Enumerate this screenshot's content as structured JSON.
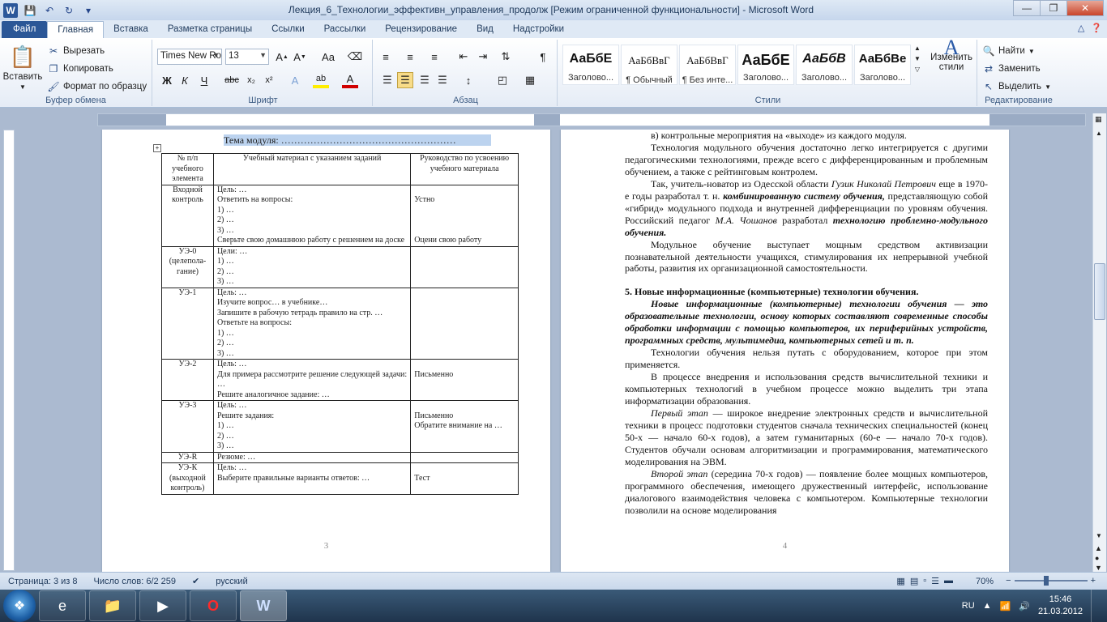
{
  "window": {
    "title": "Лекция_6_Технологии_эффективн_управления_продолж [Режим ограниченной функциональности] - Microsoft Word",
    "app_logo": "W"
  },
  "tabs": [
    "Файл",
    "Главная",
    "Вставка",
    "Разметка страницы",
    "Ссылки",
    "Рассылки",
    "Рецензирование",
    "Вид",
    "Надстройки"
  ],
  "ribbon": {
    "clipboard": {
      "label": "Буфер обмена",
      "paste": "Вставить",
      "cut": "Вырезать",
      "copy": "Копировать",
      "format_painter": "Формат по образцу"
    },
    "font": {
      "label": "Шрифт",
      "font_name": "Times New Ro",
      "font_size": "13"
    },
    "paragraph": {
      "label": "Абзац"
    },
    "styles": {
      "label": "Стили",
      "items": [
        {
          "sample": "АаБбЕ",
          "name": "Заголово..."
        },
        {
          "sample": "АаБбВвГ",
          "name": "¶ Обычный"
        },
        {
          "sample": "АаБбВвГ",
          "name": "¶ Без инте..."
        },
        {
          "sample": "АаБбЕ",
          "name": "Заголово..."
        },
        {
          "sample": "АаБбВ",
          "name": "Заголово..."
        },
        {
          "sample": "АаБбВе",
          "name": "Заголово..."
        }
      ],
      "change_styles": "Изменить стили"
    },
    "editing": {
      "label": "Редактирование",
      "find": "Найти",
      "replace": "Заменить",
      "select": "Выделить"
    }
  },
  "page3": {
    "module_title": "Тема модуля: ………………………………………………",
    "page_number": "3",
    "table": {
      "headers": [
        "№ п/п учебного элемента",
        "Учебный материал с указанием заданий",
        "Руководство по усвоению учебного материала"
      ],
      "rows": [
        {
          "c1": "Входной контроль",
          "c2": [
            "Цель: …",
            "Ответить на вопросы:",
            "1) …",
            "2) …",
            "3) …",
            "Сверьте свою домашнюю работу с решением на доске"
          ],
          "c3": [
            "",
            "Устно",
            "",
            "",
            "",
            "",
            "Оцени свою работу"
          ]
        },
        {
          "c1": "УЭ-0 (целепола-гание)",
          "c2": [
            "Цели: …",
            "1) …",
            "2) …",
            "3) …"
          ],
          "c3": []
        },
        {
          "c1": "УЭ-1",
          "c2": [
            "Цель: …",
            "Изучите вопрос… в учебнике…",
            "Запишите в рабочую тетрадь правило на стр. …",
            "Ответьте на вопросы:",
            "1) …",
            "2) …",
            "3) …"
          ],
          "c3": []
        },
        {
          "c1": "УЭ-2",
          "c2": [
            "Цель: …",
            "Для примера рассмотрите решение следующей задачи: …",
            "Решите аналогичное задание: …"
          ],
          "c3": [
            "",
            "",
            "Письменно"
          ]
        },
        {
          "c1": "УЭ-3",
          "c2": [
            "Цель: …",
            "Решите задания:",
            "1) …",
            "2) …",
            "3) …"
          ],
          "c3": [
            "",
            "Письменно",
            "Обратите внимание на …"
          ]
        },
        {
          "c1": "УЭ-R",
          "c2": [
            "Резюме: …"
          ],
          "c3": []
        },
        {
          "c1": "УЭ-К (выходной контроль)",
          "c2": [
            "Цель: …",
            "Выберите правильные варианты ответов: …"
          ],
          "c3": [
            "",
            "Тест"
          ]
        }
      ]
    }
  },
  "page4": {
    "page_number": "4",
    "p1": "в) контрольные мероприятия на «выходе» из каждого модуля.",
    "p2": "Технология модульного обучения достаточно легко интегрируется с другими педагогическими технологиями, прежде всего с дифференцированным и проблемным обучением, а также с рейтинговым контролем.",
    "p3a": "Так, учитель-новатор из Одесской области ",
    "p3b": "Гузик Николай Петрович",
    "p3c": " еще в 1970-е годы разработал т. н. ",
    "p3d": "комбинированную систему обучения,",
    "p3e": " представляющую собой «гибрид» модульного подхода и внутренней дифференциации по уровням обучения. Российский педагог ",
    "p3f": "М.А. Чошанов",
    "p3g": " разработал ",
    "p3h": "технологию проблемно-модульного обучения.",
    "p4": "Модульное обучение выступает мощным средством активизации познавательной деятельности учащихся, стимулирования их непрерывной учебной работы, развития их организационной самостоятельности.",
    "heading": "5. Новые информационные (компьютерные) технологии обучения.",
    "p5": "Новые информационные (компьютерные) технологии обучения — это образовательные технологии, основу которых составляют современные способы обработки информации с помощью компьютеров, их периферийных устройств, программных средств, мультимедиа, компьютерных сетей и т. п.",
    "p6": "Технологии обучения нельзя путать с оборудованием, которое при этом применяется.",
    "p7": "В процессе внедрения и использования средств вычислительной техники и компьютерных технологий в учебном процессе можно выделить три этапа информатизации образования.",
    "p8a": "Первый этап",
    "p8b": " — широкое внедрение электронных средств и вычислительной техники в процесс подготовки студентов сначала технических специальностей (конец 50-х — начало 60-х годов), а затем гуманитарных (60-е — начало 70-х годов). Студентов обучали основам алгоритмизации и программирования, математического моделирования на ЭВМ.",
    "p9a": "Второй этап",
    "p9b": " (середина 70-х годов) — появление более мощных компьютеров, программного обеспечения, имеющего дружественный интерфейс, использование диалогового взаимодействия человека с компьютером. Компьютерные технологии позволили на основе моделирования"
  },
  "statusbar": {
    "page": "Страница: 3 из 8",
    "words": "Число слов: 6/2 259",
    "language": "русский",
    "zoom": "70%"
  },
  "taskbar": {
    "lang": "RU",
    "time": "15:46",
    "date": "21.03.2012"
  }
}
